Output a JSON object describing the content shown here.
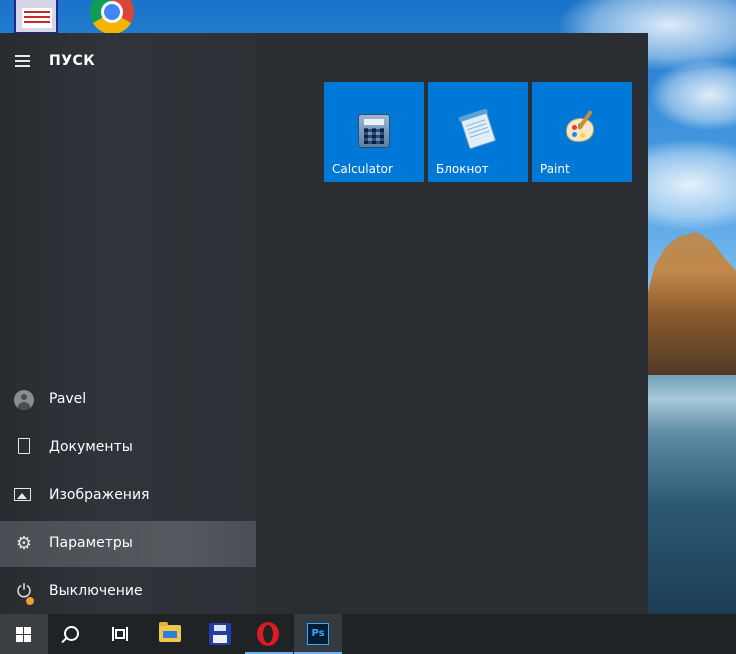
{
  "start_menu": {
    "title": "ПУСК",
    "user": {
      "name": "Pavel"
    },
    "items": [
      {
        "label": "Документы",
        "icon": "document-icon"
      },
      {
        "label": "Изображения",
        "icon": "pictures-icon"
      },
      {
        "label": "Параметры",
        "icon": "gear-icon",
        "active": true
      },
      {
        "label": "Выключение",
        "icon": "power-icon"
      }
    ],
    "tiles": [
      {
        "label": "Calculator",
        "icon": "calculator-icon"
      },
      {
        "label": "Блокнот",
        "icon": "notepad-icon"
      },
      {
        "label": "Paint",
        "icon": "paint-icon"
      }
    ]
  },
  "taskbar": {
    "buttons": [
      "windows-start",
      "search",
      "task-view",
      "file-explorer",
      "save-app",
      "opera",
      "photoshop"
    ],
    "photoshop_glyph": "Ps"
  },
  "colors": {
    "tile_accent": "#0078d7",
    "start_bg": "#2b2f33",
    "taskbar_bg": "#1f2326",
    "active_item": "#505459"
  }
}
